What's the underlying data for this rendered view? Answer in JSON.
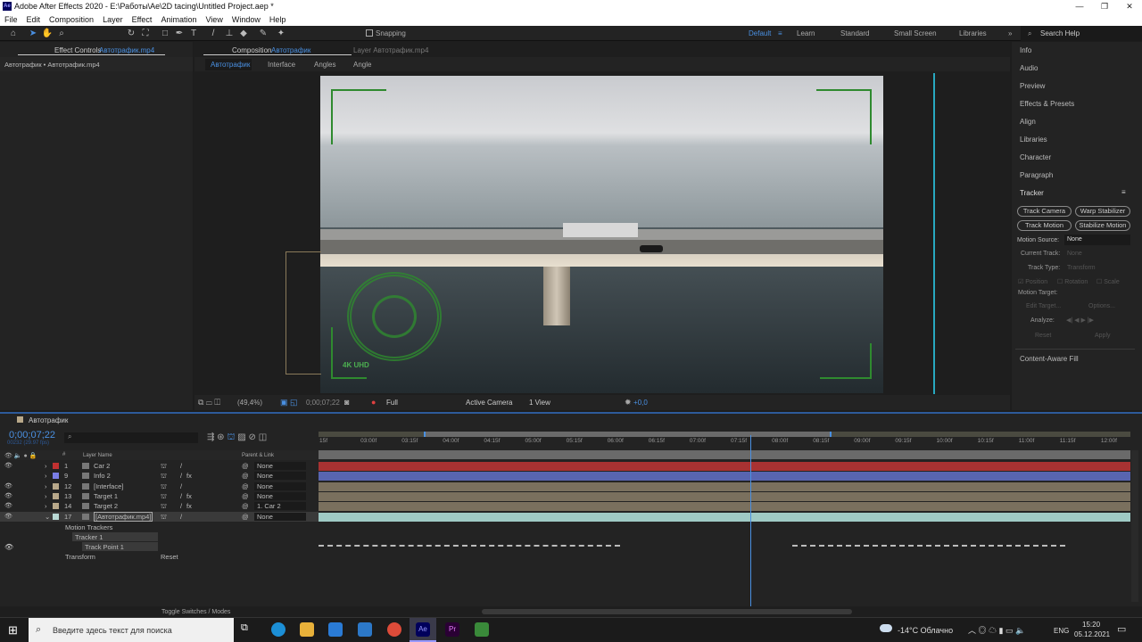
{
  "window": {
    "title": "Adobe After Effects 2020 - E:\\Работы\\Ae\\2D tacing\\Untitled Project.aep *",
    "logo": "Ae"
  },
  "menu": [
    "File",
    "Edit",
    "Composition",
    "Layer",
    "Effect",
    "Animation",
    "View",
    "Window",
    "Help"
  ],
  "toolbar": {
    "snapping": "Snapping"
  },
  "workspaces": {
    "items": [
      "Default",
      "Learn",
      "Standard",
      "Small Screen",
      "Libraries"
    ],
    "active": "Default",
    "search": "Search Help"
  },
  "effect_controls": {
    "tab": "Effect Controls",
    "tab_target": "Автотрафик.mp4",
    "breadcrumb": "Автотрафик • Автотрафик.mp4"
  },
  "composition": {
    "tab": "Composition",
    "tab_target": "Автотрафик",
    "layer_tab": "Layer Автотрафик.mp4",
    "flow": [
      "Автотрафик",
      "Interface",
      "Angles",
      "Angle"
    ],
    "overlay_label": "4K UHD"
  },
  "viewer": {
    "zoom": "(49,4%)",
    "timecode": "0;00;07;22",
    "resolution": "Full",
    "camera": "Active Camera",
    "views": "1 View",
    "exposure": "+0,0"
  },
  "right_panel": {
    "items": [
      "Info",
      "Audio",
      "Preview",
      "Effects & Presets",
      "Align",
      "Libraries",
      "Character",
      "Paragraph"
    ],
    "tracker_title": "Tracker",
    "buttons": [
      "Track Camera",
      "Warp Stabilizer",
      "Track Motion",
      "Stabilize Motion"
    ],
    "motion_source_label": "Motion Source:",
    "motion_source": "None",
    "current_track_label": "Current Track:",
    "current_track": "None",
    "track_type_label": "Track Type:",
    "track_type": "Transform",
    "position": "Position",
    "rotation": "Rotation",
    "scale": "Scale",
    "motion_target": "Motion Target:",
    "edit_target": "Edit Target...",
    "options": "Options...",
    "analyze": "Analyze:",
    "reset": "Reset",
    "apply": "Apply",
    "content_aware": "Content-Aware Fill"
  },
  "timeline": {
    "tab": "Автотрафик",
    "timecode": "0;00;07;22",
    "frames": "00232 (29.97 fps)",
    "search_placeholder": "",
    "col_layer_name": "Layer Name",
    "col_parent": "Parent & Link",
    "col_hash": "#",
    "layers": [
      {
        "num": "1",
        "name": "Car 2",
        "parent": "None",
        "label": "#c03030",
        "bar": "#a83232",
        "fx": ""
      },
      {
        "num": "9",
        "name": "Info 2",
        "parent": "None",
        "label": "#7a7ee6",
        "bar": "#5865b0",
        "fx": "fx"
      },
      {
        "num": "12",
        "name": "[Interface]",
        "parent": "None",
        "label": "#b8a88a",
        "bar": "#7a705e",
        "fx": ""
      },
      {
        "num": "13",
        "name": "Target 1",
        "parent": "None",
        "label": "#b8a88a",
        "bar": "#7a705e",
        "fx": "fx"
      },
      {
        "num": "14",
        "name": "Target 2",
        "parent": "1. Car 2",
        "label": "#b8a88a",
        "bar": "#7a705e",
        "fx": "fx"
      },
      {
        "num": "17",
        "name": "[Автотрафик.mp4]",
        "parent": "None",
        "label": "#b8d8d4",
        "bar": "#9fcac5",
        "fx": ""
      }
    ],
    "sub": {
      "motion_trackers": "Motion Trackers",
      "tracker": "Tracker 1",
      "track_point": "Track Point 1",
      "transform": "Transform",
      "reset": "Reset"
    },
    "ticks": [
      "15f",
      "03:00f",
      "03:15f",
      "04:00f",
      "04:15f",
      "05:00f",
      "05:15f",
      "06:00f",
      "06:15f",
      "07:00f",
      "07:15f",
      "08:00f",
      "08:15f",
      "09:00f",
      "09:15f",
      "10:00f",
      "10:15f",
      "11:00f",
      "11:15f",
      "12:00f"
    ],
    "toggle": "Toggle Switches / Modes"
  },
  "taskbar": {
    "search_placeholder": "Введите здесь текст для поиска",
    "weather": "-14°C  Облачно",
    "lang": "ENG",
    "time": "15:20",
    "date": "05.12.2021"
  }
}
